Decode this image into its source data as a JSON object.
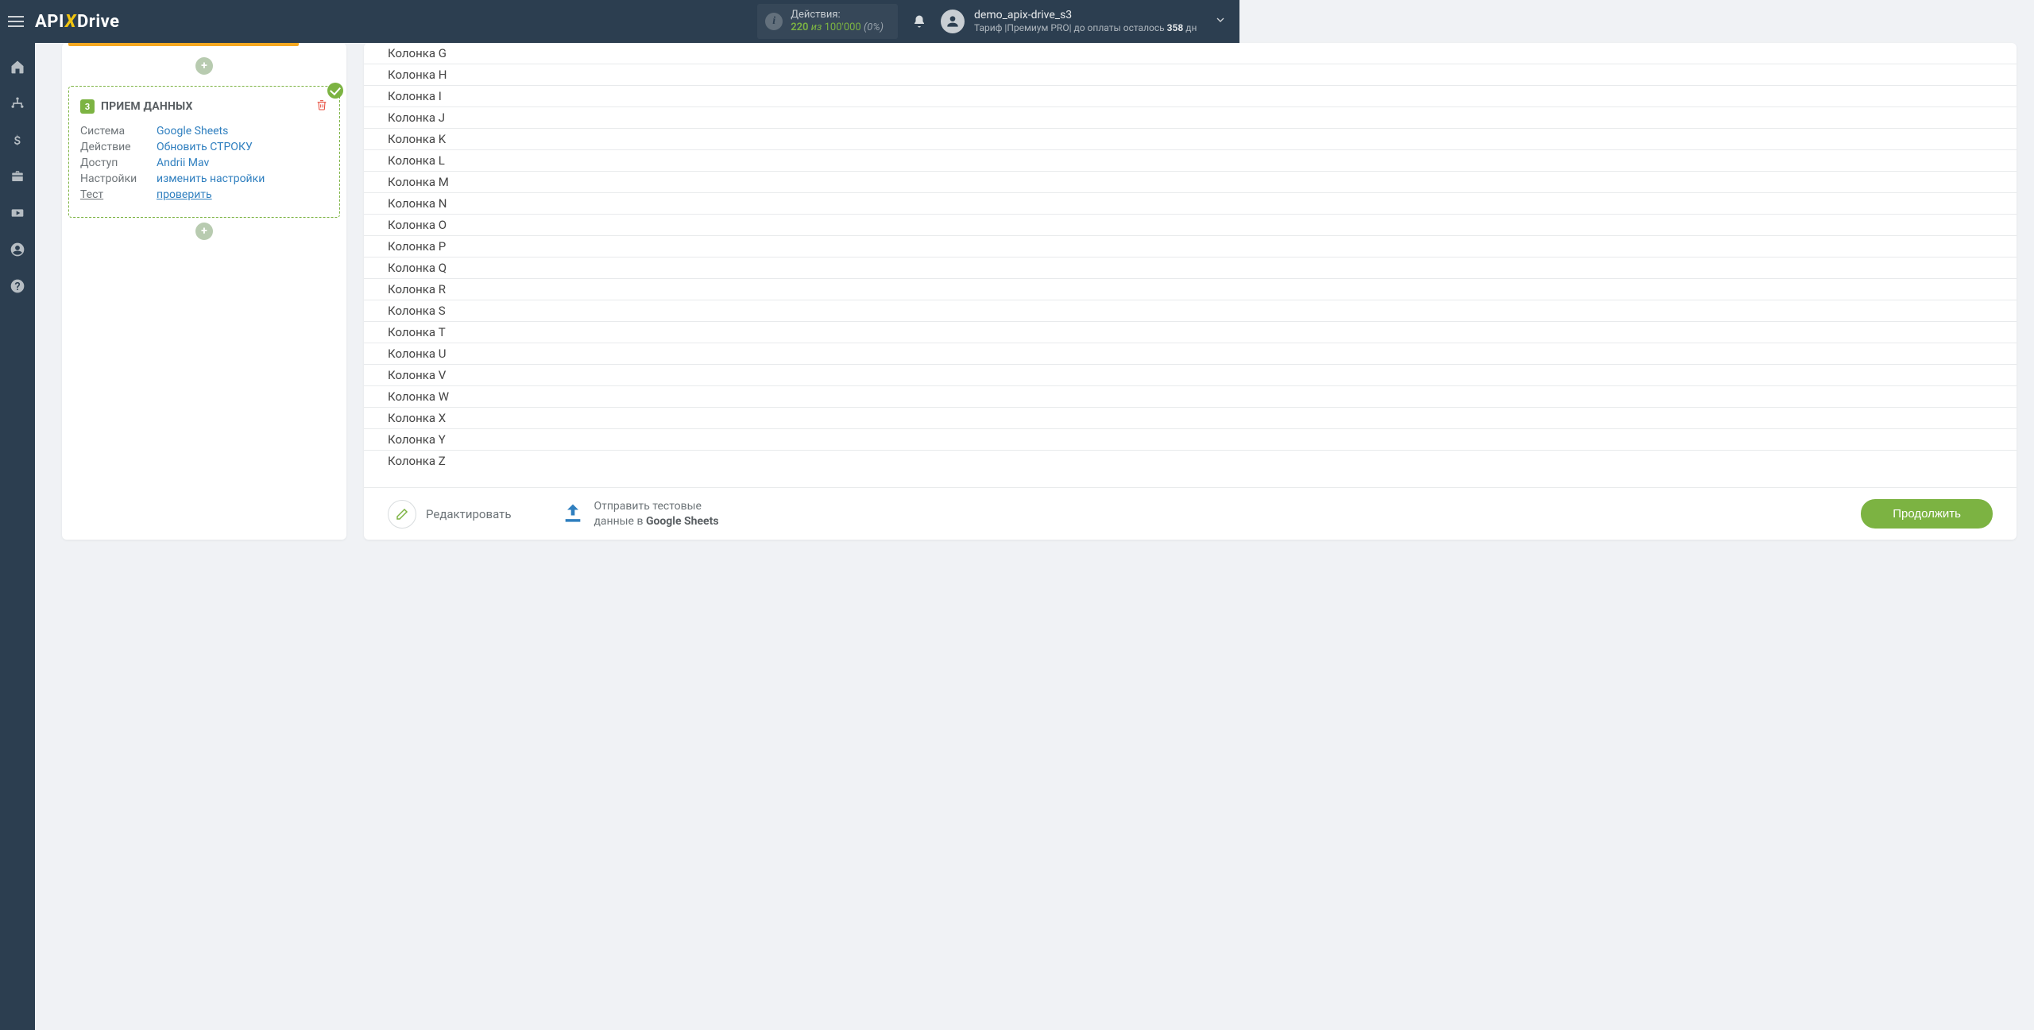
{
  "topbar": {
    "logo": {
      "part1": "API",
      "part2": "X",
      "part3": "Drive"
    },
    "actions": {
      "title": "Действия:",
      "used": "220",
      "of_word": "из",
      "limit": "100'000",
      "percent": "(0%)"
    },
    "user": {
      "name": "demo_apix-drive_s3",
      "tariff_prefix": "Тариф |",
      "tariff": "Премиум PRO",
      "pay_prefix": "| до оплаты осталось ",
      "days": "358",
      "days_suffix": " дн"
    }
  },
  "step": {
    "number": "3",
    "title": "ПРИЕМ ДАННЫХ",
    "rows": [
      {
        "k": "Система",
        "v": "Google Sheets",
        "link": false,
        "kUnder": false
      },
      {
        "k": "Действие",
        "v": "Обновить СТРОКУ",
        "link": false,
        "kUnder": false
      },
      {
        "k": "Доступ",
        "v": "Andrii Mav",
        "link": false,
        "kUnder": false
      },
      {
        "k": "Настройки",
        "v": "изменить настройки",
        "link": false,
        "kUnder": false
      },
      {
        "k": "Тест",
        "v": "проверить",
        "link": true,
        "kUnder": true
      }
    ]
  },
  "columns": [
    "Колонка G",
    "Колонка H",
    "Колонка I",
    "Колонка J",
    "Колонка K",
    "Колонка L",
    "Колонка M",
    "Колонка N",
    "Колонка O",
    "Колонка P",
    "Колонка Q",
    "Колонка R",
    "Колонка S",
    "Колонка T",
    "Колонка U",
    "Колонка V",
    "Колонка W",
    "Колонка X",
    "Колонка Y",
    "Колонка Z"
  ],
  "footer": {
    "edit": "Редактировать",
    "upload_line1": "Отправить тестовые",
    "upload_line2_a": "данные в ",
    "upload_line2_b": "Google Sheets",
    "continue": "Продолжить"
  },
  "add_label": "+"
}
